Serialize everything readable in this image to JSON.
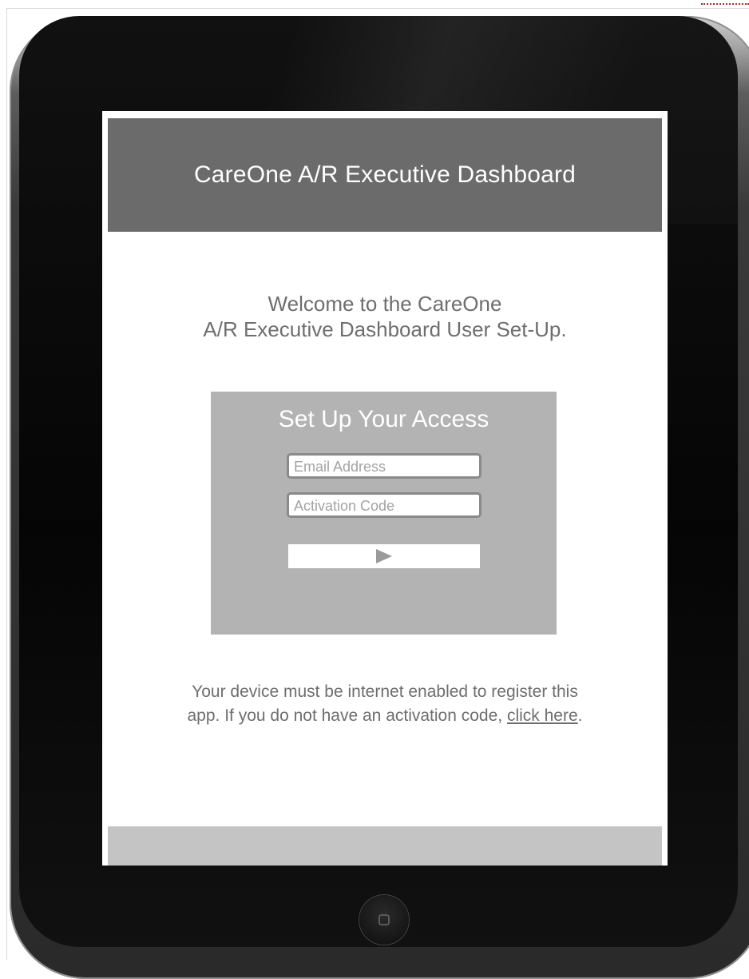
{
  "app": {
    "title": "CareOne A/R Executive Dashboard"
  },
  "welcome": {
    "line1": "Welcome to the CareOne",
    "line2": "A/R Executive Dashboard User Set-Up."
  },
  "access_form": {
    "title": "Set Up Your Access",
    "email": {
      "value": "",
      "placeholder": "Email Address"
    },
    "activation_code": {
      "value": "",
      "placeholder": "Activation Code"
    },
    "submit_icon": "play-icon"
  },
  "info": {
    "text_before": "Your device must be internet enabled to register this app.  If you do not have an activation code, ",
    "link_text": "click here",
    "text_after": "."
  },
  "colors": {
    "header": "#6b6b6b",
    "panel": "#b3b3b3",
    "footer": "#c4c4c4",
    "text": "#6e6e6e"
  }
}
